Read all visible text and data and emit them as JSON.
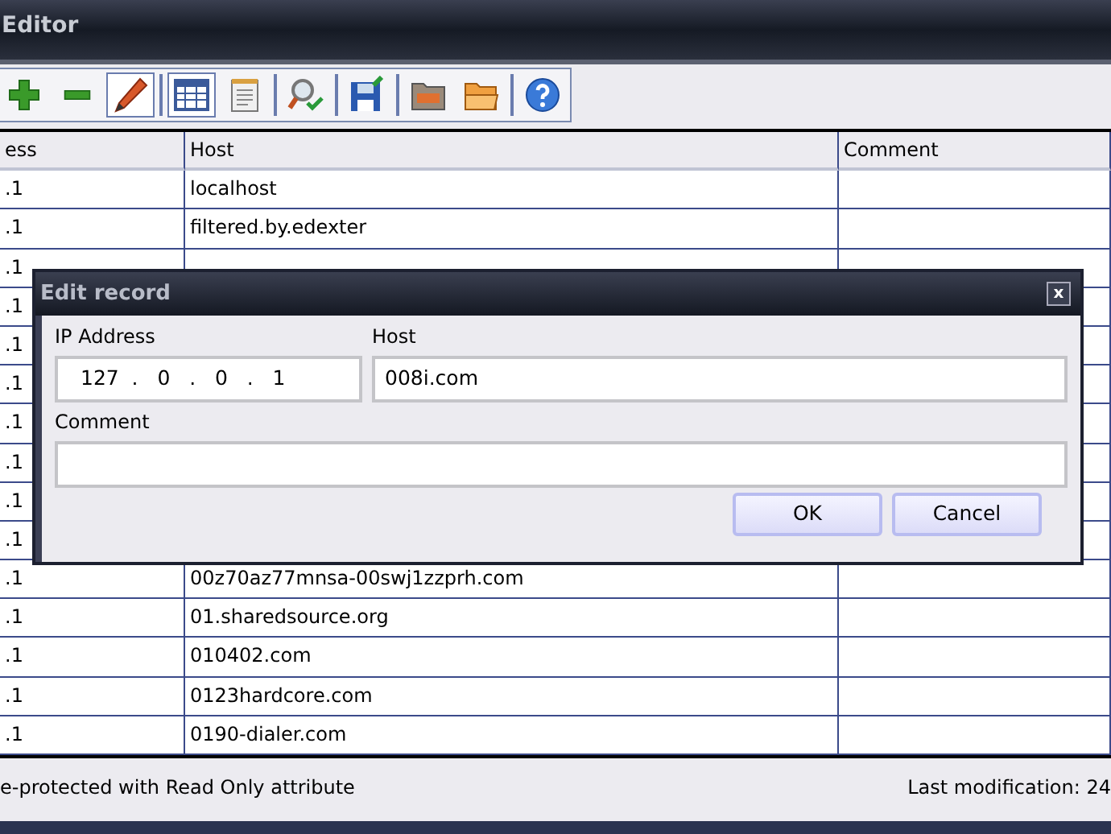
{
  "window": {
    "title": "Editor"
  },
  "toolbar": [
    {
      "kind": "add",
      "pressed": false
    },
    {
      "kind": "remove",
      "pressed": false
    },
    {
      "kind": "edit",
      "pressed": true
    },
    {
      "kind": "sep"
    },
    {
      "kind": "table",
      "pressed": true
    },
    {
      "kind": "notes",
      "pressed": false
    },
    {
      "kind": "sep"
    },
    {
      "kind": "find",
      "pressed": false
    },
    {
      "kind": "sep"
    },
    {
      "kind": "save",
      "pressed": false
    },
    {
      "kind": "sep"
    },
    {
      "kind": "folder",
      "pressed": false
    },
    {
      "kind": "open",
      "pressed": false
    },
    {
      "kind": "sep"
    },
    {
      "kind": "help",
      "pressed": false
    }
  ],
  "table": {
    "columns": [
      "ess",
      "Host",
      "Comment"
    ],
    "rows": [
      {
        "ip": ".1",
        "host": "localhost"
      },
      {
        "ip": ".1",
        "host": "filtered.by.edexter"
      },
      {
        "ip": ".1"
      },
      {
        "ip": ".1"
      },
      {
        "ip": ".1"
      },
      {
        "ip": ".1"
      },
      {
        "ip": ".1"
      },
      {
        "ip": ".1"
      },
      {
        "ip": ".1"
      },
      {
        "ip": ".1"
      },
      {
        "ip": ".1",
        "host": "00z70az77mnsa-00swj1zzprh.com"
      },
      {
        "ip": ".1",
        "host": "01.sharedsource.org"
      },
      {
        "ip": ".1",
        "host": "010402.com"
      },
      {
        "ip": ".1",
        "host": "0123hardcore.com"
      },
      {
        "ip": ".1",
        "host": "0190-dialer.com"
      }
    ]
  },
  "status_bar": {
    "left": "e-protected with Read Only attribute",
    "right": "Last modification:  24"
  },
  "dialog": {
    "title": "Edit record",
    "close": "x",
    "ip_label": "IP Address",
    "ip_value": "127  .   0   .   0   .   1",
    "host_label": "Host",
    "host_value": "008i.com",
    "comment_label": "Comment",
    "buttons": [
      "OK",
      "Cancel"
    ]
  }
}
